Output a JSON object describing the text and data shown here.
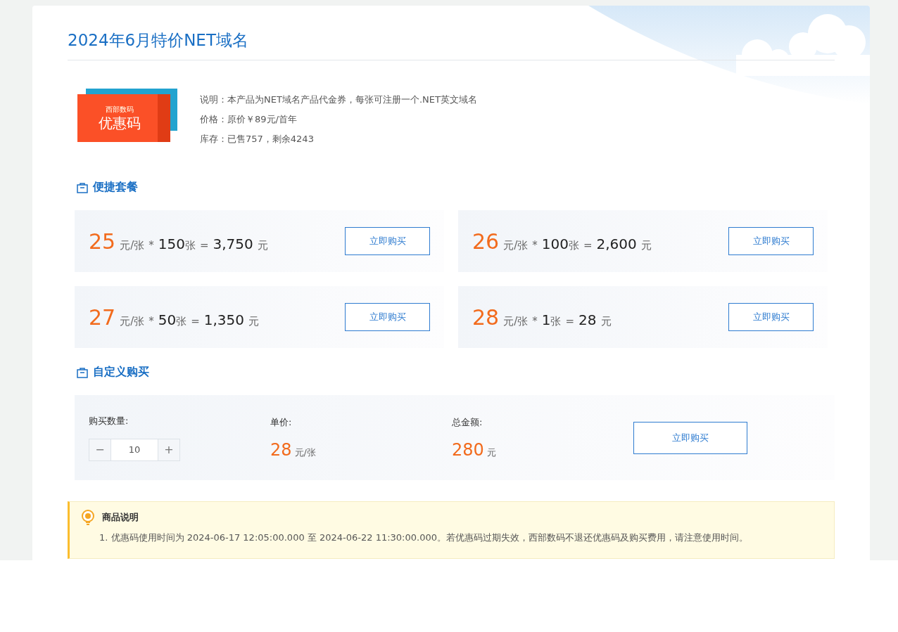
{
  "title": "2024年6月特价NET域名",
  "coupon": {
    "brand": "西部数码",
    "label": "优惠码"
  },
  "info": [
    "说明：本产品为NET域名产品代金券，每张可注册一个.NET英文域名",
    "价格：原价￥89元/首年",
    "库存：已售757，剩余4243"
  ],
  "packages_section": {
    "title": "便捷套餐"
  },
  "packages": [
    {
      "price": "25",
      "unit": "元/张",
      "times": "*",
      "count": "150",
      "count_unit": "张",
      "equals": "=",
      "total": "3,750",
      "currency": "元",
      "button": "立即购买"
    },
    {
      "price": "26",
      "unit": "元/张",
      "times": "*",
      "count": "100",
      "count_unit": "张",
      "equals": "=",
      "total": "2,600",
      "currency": "元",
      "button": "立即购买"
    },
    {
      "price": "27",
      "unit": "元/张",
      "times": "*",
      "count": "50",
      "count_unit": "张",
      "equals": "=",
      "total": "1,350",
      "currency": "元",
      "button": "立即购买"
    },
    {
      "price": "28",
      "unit": "元/张",
      "times": "*",
      "count": "1",
      "count_unit": "张",
      "equals": "=",
      "total": "28",
      "currency": "元",
      "button": "立即购买"
    }
  ],
  "custom_section": {
    "title": "自定义购买"
  },
  "custom": {
    "quantity_label": "购买数量:",
    "minus": "−",
    "quantity": "10",
    "plus": "+",
    "unit_price_label": "单价:",
    "unit_price": "28",
    "unit_price_unit": "元/张",
    "total_label": "总金额:",
    "total": "280",
    "total_unit": "元",
    "button": "立即购买"
  },
  "notice": {
    "title": "商品说明",
    "items": [
      "1. 优惠码使用时间为 2024-06-17 12:05:00.000 至 2024-06-22 11:30:00.000。若优惠码过期失效，西部数码不退还优惠码及购买费用，请注意使用时间。"
    ]
  }
}
